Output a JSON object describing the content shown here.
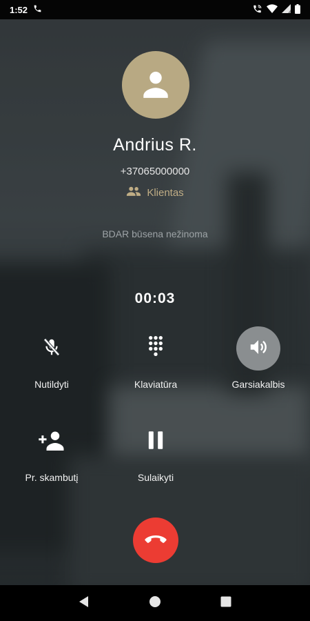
{
  "status_bar": {
    "time": "1:52"
  },
  "caller": {
    "name": "Andrius R.",
    "number": "+37065000000",
    "group": "Klientas",
    "gdpr_status": "BDAR būsena nežinoma"
  },
  "call": {
    "timer": "00:03"
  },
  "actions": {
    "mute": "Nutildyti",
    "keypad": "Klaviatūra",
    "speaker": "Garsiakalbis",
    "add_call": "Pr. skambutį",
    "hold": "Sulaikyti"
  },
  "colors": {
    "avatar": "#b8a983",
    "group_text": "#c0ad85",
    "end_call": "#ec3c33",
    "speaker_active": "#8a8e90"
  }
}
